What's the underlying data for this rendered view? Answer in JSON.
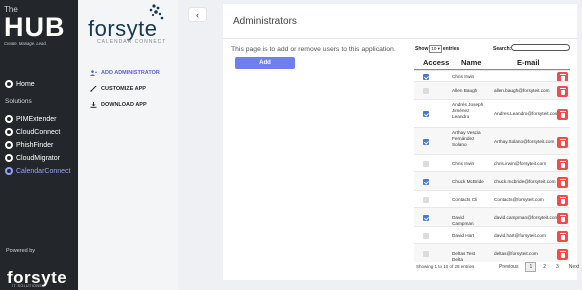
{
  "sidebar": {
    "logo_small": "The",
    "logo_big": "HUB",
    "tagline": "Create. Manage. Lead.",
    "home_label": "Home",
    "section_label": "Solutions",
    "items": [
      {
        "label": "PIMExtender"
      },
      {
        "label": "CloudConnect"
      },
      {
        "label": "PhishFinder"
      },
      {
        "label": "CloudMigrator"
      },
      {
        "label": "CalendarConnect"
      }
    ],
    "powered_by": "Powered by",
    "brand": "forsyte",
    "brand_tag": "IT SOLUTIONS",
    "active_color": "#9aa0f5"
  },
  "app_menu": {
    "logo": "forsyte",
    "logo_sub": "CALENDAR CONNECT",
    "items": [
      {
        "label": "ADD ADMINISTRATOR",
        "icon": "add-user-icon"
      },
      {
        "label": "CUSTOMIZE APP",
        "icon": "brush-icon"
      },
      {
        "label": "DOWNLOAD APP",
        "icon": "download-icon"
      }
    ]
  },
  "collapse_icon": "‹",
  "main": {
    "title": "Administrators",
    "description": "This page is to add or remove users to this application.",
    "add_button": "Add",
    "accent_color": "#6f7ef0"
  },
  "table": {
    "show_label": "Show",
    "show_value": "10",
    "entries_label": "entries",
    "search_label": "Search:",
    "search_value": "",
    "columns": [
      "Access",
      "Name",
      "E-mail"
    ],
    "rows": [
      {
        "access": true,
        "name": "Chris Irwin",
        "email": ""
      },
      {
        "access": false,
        "name": "Allen Baugh",
        "email": "allen.baugh@forsyteit.com"
      },
      {
        "access": true,
        "name": "Andrés Joseph Jiménez Leandro",
        "email": "Andres.Leandro@forsyteit.com"
      },
      {
        "access": true,
        "name": "Arthay Vescia Fernández Solano",
        "email": "Arthay.Solano@forsyteit.com"
      },
      {
        "access": false,
        "name": "Chris Irwin",
        "email": "chris.irwin@forsyteit.com"
      },
      {
        "access": true,
        "name": "Chuck McBride",
        "email": "chuck.mcbride@forsyteit.com"
      },
      {
        "access": false,
        "name": "Contacts Cli",
        "email": "Contacts@forsyteit.com"
      },
      {
        "access": true,
        "name": "David Campman",
        "email": "david.campman@forsyteit.com"
      },
      {
        "access": false,
        "name": "David Hart",
        "email": "david.hart@forsyteit.com"
      },
      {
        "access": false,
        "name": "Deltas Test Delta",
        "email": "deltas@forsyteit.com"
      }
    ],
    "showing": "Showing 1 to 10 of 28 entries",
    "pager": {
      "previous": "Previous",
      "pages": [
        "1",
        "2",
        "3"
      ],
      "next": "Next",
      "current": "1"
    },
    "delete_color": "#f04c4c",
    "check_color": "#4a78d6"
  }
}
